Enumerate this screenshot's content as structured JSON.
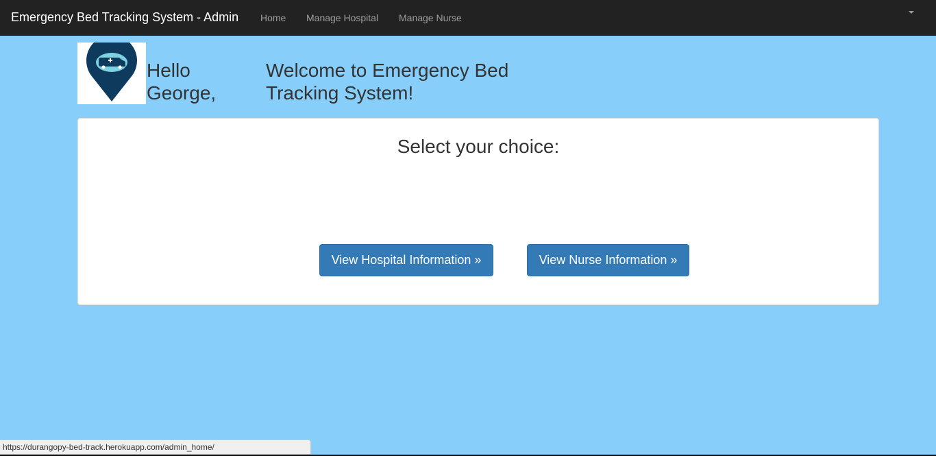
{
  "navbar": {
    "brand": "Emergency Bed Tracking System - Admin",
    "links": [
      "Home",
      "Manage Hospital",
      "Manage Nurse"
    ]
  },
  "header": {
    "logo_icon": "ambulance-map-pin-icon",
    "hello": "Hello George,",
    "welcome": "Welcome to Emergency Bed Tracking System!"
  },
  "panel": {
    "title": "Select your choice:",
    "hospital_button": "View Hospital Information »",
    "nurse_button": "View Nurse Information »"
  },
  "statusbar": {
    "url": "https://durangopy-bed-track.herokuapp.com/admin_home/"
  },
  "colors": {
    "background": "#87cefa",
    "navbar": "#222222",
    "primary_button": "#337ab7"
  }
}
